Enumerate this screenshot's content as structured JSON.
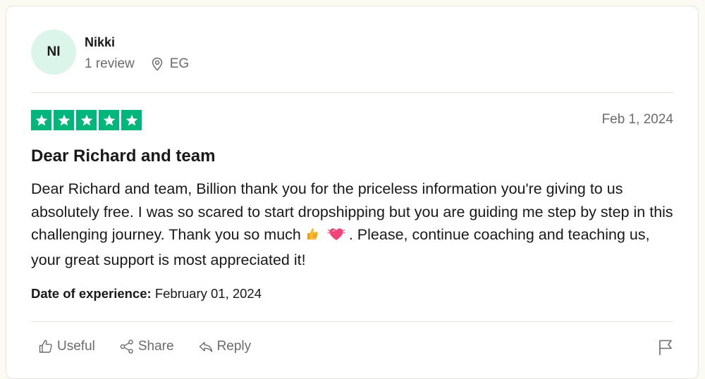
{
  "reviewer": {
    "initials": "NI",
    "name": "Nikki",
    "review_count": "1 review",
    "country": "EG"
  },
  "review": {
    "rating": 5,
    "rating_max": 5,
    "date": "Feb 1, 2024",
    "title": "Dear Richard and team",
    "body_part1": "Dear Richard and team, Billion thank you for the priceless information you're giving to us absolutely free. I was so scared to start dropshipping but you are guiding me step by step in this challenging journey. Thank you so much",
    "body_part2": ". Please, continue coaching and teaching us, your great support is most appreciated it!",
    "experience_label": "Date of experience:",
    "experience_date": "February 01, 2024"
  },
  "actions": {
    "useful": "Useful",
    "share": "Share",
    "reply": "Reply"
  },
  "icons": {
    "location": "map-pin-icon",
    "star": "star-icon",
    "useful": "thumbs-up-icon",
    "share": "share-icon",
    "reply": "reply-icon",
    "flag": "flag-icon",
    "emoji1": "thumbs-up-emoji",
    "emoji2": "beating-heart-emoji"
  },
  "colors": {
    "star_bg": "#00b67a",
    "avatar_bg": "#dcf5ea",
    "muted_text": "#6b6b6b"
  }
}
